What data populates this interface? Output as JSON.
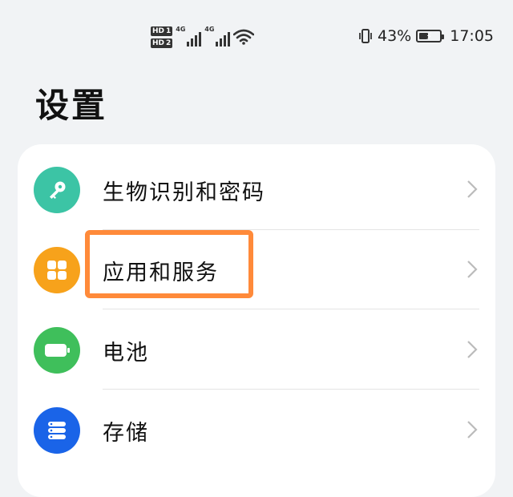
{
  "status_bar": {
    "hd_badges": [
      {
        "text": "HD",
        "sim": "1"
      },
      {
        "text": "HD",
        "sim": "2"
      }
    ],
    "network_labels": [
      "4G",
      "4G"
    ],
    "battery_percent": "43%",
    "battery_level": 0.43,
    "time": "17:05",
    "icons": [
      "hd-icon",
      "signal-icon",
      "wifi-icon",
      "vibrate-icon",
      "battery-charging-icon"
    ]
  },
  "page": {
    "title": "设置"
  },
  "settings_items": [
    {
      "label": "生物识别和密码",
      "icon": "key-icon",
      "icon_color": "#3cc4a5"
    },
    {
      "label": "应用和服务",
      "icon": "apps-grid-icon",
      "icon_color": "#f7a21b"
    },
    {
      "label": "电池",
      "icon": "battery-icon",
      "icon_color": "#3fbf5b"
    },
    {
      "label": "存储",
      "icon": "storage-icon",
      "icon_color": "#1a64e8"
    }
  ],
  "highlight_color": "#ff8a3a"
}
